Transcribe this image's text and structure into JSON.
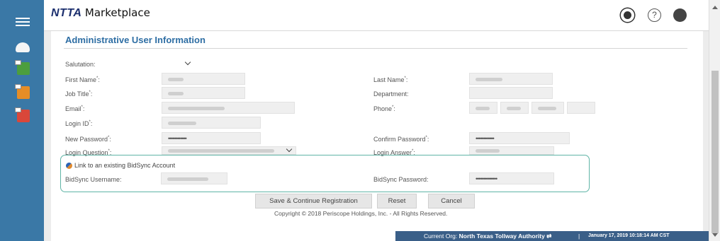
{
  "header": {
    "brand_ntta": "NTTA",
    "brand_marketplace": "Marketplace",
    "help_glyph": "?"
  },
  "sidebar": {
    "icons": [
      "menu-icon",
      "dashboard-icon",
      "spreadsheet-icon",
      "document-icon",
      "pdf-icon"
    ]
  },
  "form": {
    "title": "Administrative User Information",
    "salutation_label": "Salutation:",
    "first_name_label": "First Name",
    "last_name_label": "Last Name",
    "job_title_label": "Job Title",
    "department_label": "Department:",
    "email_label": "Email",
    "phone_label": "Phone",
    "login_id_label": "Login ID",
    "new_password_label": "New Password",
    "new_password_value": "••••••••••••",
    "confirm_password_label": "Confirm Password",
    "confirm_password_value": "••••••••••••",
    "login_question_label": "Login Question",
    "login_answer_label": "Login Answer",
    "required_mark": "*",
    "colon": ":"
  },
  "bidsync": {
    "link_label": "Link to an existing BidSync Account",
    "username_label": "BidSync Username:",
    "password_label": "BidSync Password:",
    "password_value": "••••••••••••••"
  },
  "actions": {
    "save_label": "Save & Continue Registration",
    "reset_label": "Reset",
    "cancel_label": "Cancel"
  },
  "footer": {
    "copyright": "Copyright © 2018 Periscope Holdings, Inc. - All Rights Reserved."
  },
  "status": {
    "org_prefix": "Current Org:",
    "org_name": "North Texas Tollway Authority",
    "switch_glyph": "⇄",
    "separator": "|",
    "timestamp": "January 17, 2019 10:18:14 AM CST"
  },
  "colors": {
    "sidebar": "#3a78a6",
    "title": "#2e6ea4",
    "highlight_box": "#5fb4a6",
    "statusbar": "#3a5f88"
  }
}
